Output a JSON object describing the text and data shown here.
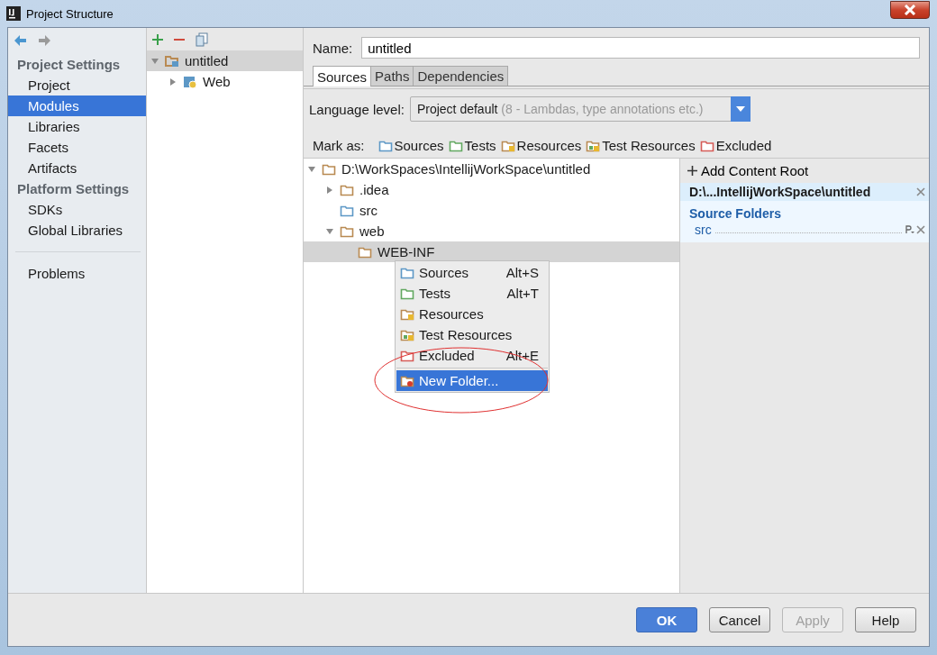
{
  "window": {
    "title": "Project Structure"
  },
  "sidebar": {
    "sections": [
      {
        "title": "Project Settings",
        "items": [
          {
            "label": "Project",
            "selected": false
          },
          {
            "label": "Modules",
            "selected": true
          },
          {
            "label": "Libraries",
            "selected": false
          },
          {
            "label": "Facets",
            "selected": false
          },
          {
            "label": "Artifacts",
            "selected": false
          }
        ]
      },
      {
        "title": "Platform Settings",
        "items": [
          {
            "label": "SDKs",
            "selected": false
          },
          {
            "label": "Global Libraries",
            "selected": false
          }
        ]
      }
    ],
    "extra_items": [
      {
        "label": "Problems",
        "selected": false
      }
    ]
  },
  "module_tree": [
    {
      "label": "untitled",
      "kind": "module",
      "expanded": true,
      "selected": true,
      "children": [
        {
          "label": "Web",
          "kind": "facet",
          "expanded": false,
          "selected": false
        }
      ]
    }
  ],
  "name_field": {
    "label": "Name:",
    "value": "untitled"
  },
  "tabs": [
    {
      "label": "Sources",
      "selected": true
    },
    {
      "label": "Paths",
      "selected": false
    },
    {
      "label": "Dependencies",
      "selected": false
    }
  ],
  "language_level": {
    "label": "Language level:",
    "value": "Project default",
    "hint": "(8 - Lambdas, type annotations etc.)"
  },
  "mark_as": {
    "label": "Mark as:",
    "options": [
      {
        "label": "Sources",
        "kind": "sources"
      },
      {
        "label": "Tests",
        "kind": "tests"
      },
      {
        "label": "Resources",
        "kind": "resources"
      },
      {
        "label": "Test Resources",
        "kind": "test-resources"
      },
      {
        "label": "Excluded",
        "kind": "excluded"
      }
    ]
  },
  "folder_tree": [
    {
      "label": "D:\\WorkSpaces\\IntellijWorkSpace\\untitled",
      "kind": "plain",
      "expanded": true,
      "selected": false,
      "children": [
        {
          "label": ".idea",
          "kind": "plain",
          "expanded": false,
          "selected": false
        },
        {
          "label": "src",
          "kind": "sources",
          "selected": false
        },
        {
          "label": "web",
          "kind": "plain",
          "expanded": true,
          "selected": false,
          "children": [
            {
              "label": "WEB-INF",
              "kind": "plain",
              "selected": true
            }
          ]
        }
      ]
    }
  ],
  "context_menu": [
    {
      "label": "Sources",
      "shortcut": "Alt+S",
      "kind": "sources",
      "selected": false
    },
    {
      "label": "Tests",
      "shortcut": "Alt+T",
      "kind": "tests",
      "selected": false
    },
    {
      "label": "Resources",
      "kind": "resources",
      "selected": false
    },
    {
      "label": "Test Resources",
      "kind": "test-resources",
      "selected": false
    },
    {
      "label": "Excluded",
      "shortcut": "Alt+E",
      "kind": "excluded",
      "selected": false
    },
    {
      "label": "New Folder...",
      "kind": "new-folder",
      "selected": true
    }
  ],
  "content_root": {
    "add_button": "Add Content Root",
    "root": "D:\\...IntellijWorkSpace\\untitled",
    "section": "Source Folders",
    "folders": [
      {
        "label": "src"
      }
    ]
  },
  "buttons": [
    {
      "label": "OK",
      "kind": "primary",
      "disabled": false
    },
    {
      "label": "Cancel",
      "kind": "normal",
      "disabled": false
    },
    {
      "label": "Apply",
      "kind": "normal",
      "disabled": true
    },
    {
      "label": "Help",
      "kind": "normal",
      "disabled": false
    }
  ]
}
